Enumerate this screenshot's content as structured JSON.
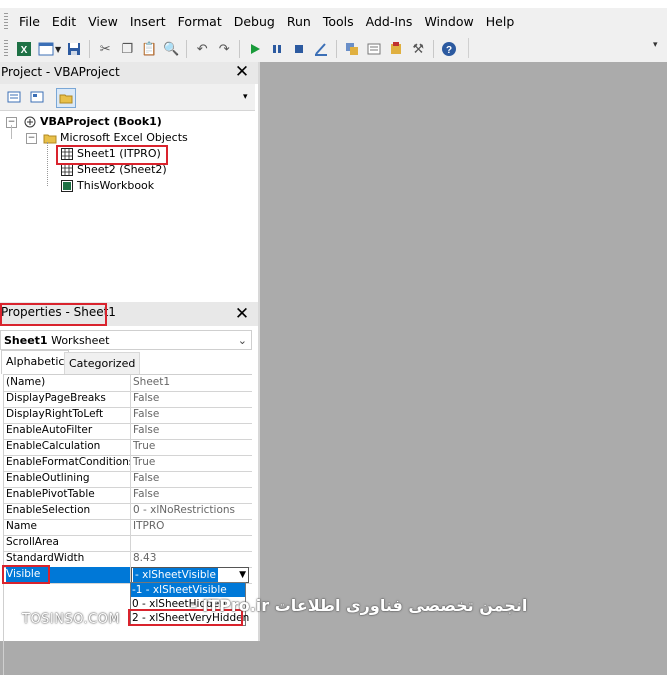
{
  "menu": [
    "File",
    "Edit",
    "View",
    "Insert",
    "Format",
    "Debug",
    "Run",
    "Tools",
    "Add-Ins",
    "Window",
    "Help"
  ],
  "toolbar": {
    "buttons": [
      "excel-icon",
      "insert-userform-icon",
      "save-icon",
      "cut-icon",
      "copy-icon",
      "paste-icon",
      "find-icon",
      "undo-icon",
      "redo-icon",
      "run-icon",
      "break-icon",
      "reset-icon",
      "design-mode-icon",
      "project-explorer-icon",
      "properties-window-icon",
      "object-browser-icon",
      "toolbox-icon",
      "help-icon"
    ]
  },
  "project": {
    "title": "Project - VBAProject",
    "close": "✕",
    "tree": {
      "root": "VBAProject (Book1)",
      "folder": "Microsoft Excel Objects",
      "items": [
        "Sheet1 (ITPRO)",
        "Sheet2 (Sheet2)",
        "ThisWorkbook"
      ]
    }
  },
  "properties": {
    "title": "Properties - Sheet1",
    "close": "✕",
    "object_name": "Sheet1",
    "object_type": "Worksheet",
    "tabs": [
      "Alphabetic",
      "Categorized"
    ],
    "rows": [
      {
        "name": "(Name)",
        "value": "Sheet1"
      },
      {
        "name": "DisplayPageBreaks",
        "value": "False"
      },
      {
        "name": "DisplayRightToLeft",
        "value": "False"
      },
      {
        "name": "EnableAutoFilter",
        "value": "False"
      },
      {
        "name": "EnableCalculation",
        "value": "True"
      },
      {
        "name": "EnableFormatConditionsCalculation",
        "value": "True"
      },
      {
        "name": "EnableOutlining",
        "value": "False"
      },
      {
        "name": "EnablePivotTable",
        "value": "False"
      },
      {
        "name": "EnableSelection",
        "value": "0 - xlNoRestrictions"
      },
      {
        "name": "Name",
        "value": "ITPRO"
      },
      {
        "name": "ScrollArea",
        "value": ""
      },
      {
        "name": "StandardWidth",
        "value": "8.43"
      }
    ],
    "visible": {
      "name": "Visible",
      "value": "- xlSheetVisible",
      "options": [
        "-1 - xlSheetVisible",
        "0 - xlSheetHidden",
        "2 - xlSheetVeryHidden"
      ]
    }
  },
  "watermark": {
    "left": "TOSINSO.COM",
    "right": "انجمن تخصصی فناوری اطلاعات ITPro.ir -"
  },
  "colors": {
    "highlight": "#d9232d",
    "selection": "#0078d7",
    "mdi_background": "#ababab"
  }
}
